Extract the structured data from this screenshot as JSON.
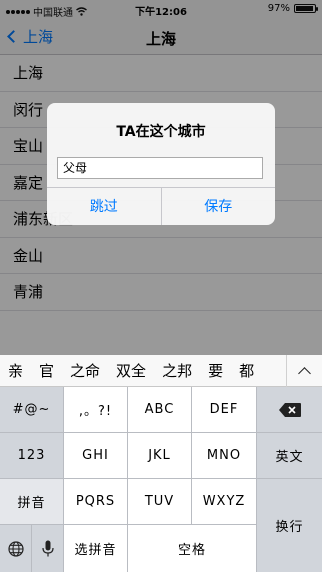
{
  "status_bar": {
    "dots": 5,
    "carrier": "中国联通",
    "time": "下午12:06",
    "battery_text": "97%",
    "battery_level": 0.97
  },
  "nav": {
    "back_label": "上海",
    "title": "上海"
  },
  "districts": [
    "上海",
    "闵行",
    "宝山",
    "嘉定",
    "浦东新区",
    "金山",
    "青浦"
  ],
  "alert": {
    "title": "TA在这个城市",
    "field_value": "父母",
    "skip_label": "跳过",
    "save_label": "保存"
  },
  "keyboard": {
    "candidates": [
      "亲",
      "官",
      "之命",
      "双全",
      "之邦",
      "要",
      "都"
    ],
    "symbols": "#@~",
    "punct": ",。?!",
    "abc": "ABC",
    "def": "DEF",
    "num": "123",
    "ghi": "GHI",
    "jkl": "JKL",
    "mno": "MNO",
    "english": "英文",
    "pinyin": "拼音",
    "pqrs": "PQRS",
    "tuv": "TUV",
    "wxyz": "WXYZ",
    "enter": "换行",
    "select_pinyin": "选拼音",
    "space": "空格"
  }
}
